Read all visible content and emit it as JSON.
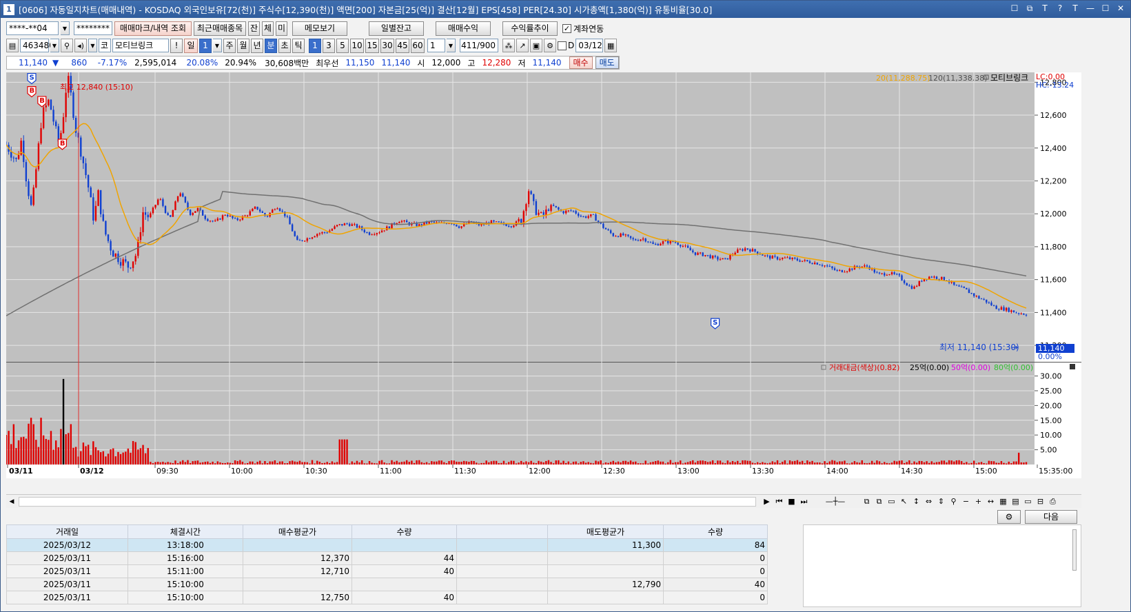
{
  "window": {
    "app_number": "1",
    "title": "[0606] 자동일지차트(매매내역) - KOSDAQ 외국인보유[72(천)] 주식수[12,390(천)] 액면[200] 자본금[25(억)] 결산[12월] EPS[458] PER[24.30] 시가총액[1,380(억)] 유통비율[30.0]",
    "buttons": [
      "☐",
      "⧉",
      "T",
      "?",
      "T",
      "—",
      "☐",
      "✕"
    ]
  },
  "toolbar1": {
    "account": "****-**04",
    "password": "********",
    "btn_trade_mark": "매매마크/내역 조회",
    "btn_recent": "최근매매종목",
    "btn_jan": "잔",
    "btn_che": "체",
    "btn_mi": "미",
    "btn_memo": "메모보기",
    "btn_daily": "일별잔고",
    "btn_profit": "매매수익",
    "btn_profit_rate": "수익률추이",
    "chk_account_link": "계좌연동"
  },
  "toolbar2": {
    "code": "463480",
    "market": "코",
    "stock_name": "모티브링크",
    "excl": "!",
    "period_day": "일",
    "period_day_n": "1",
    "periods": [
      "주",
      "월",
      "년",
      "분",
      "초",
      "틱"
    ],
    "minute_options": [
      "1",
      "3",
      "5",
      "10",
      "15",
      "30",
      "45",
      "60"
    ],
    "n_value": "1",
    "count": "411",
    "count_max": "/900",
    "d_label": "D",
    "date": "03/12"
  },
  "quote": {
    "price": "11,140",
    "arrow": "▼",
    "change": "860",
    "change_pct": "-7.17%",
    "volume": "2,595,014",
    "rate1": "20.08%",
    "rate2": "20.94%",
    "amount": "30,608백만",
    "best_label": "최우선",
    "best_ask": "11,150",
    "best_bid": "11,140",
    "open_label": "시",
    "open": "12,000",
    "high_label": "고",
    "high": "12,280",
    "low_label": "저",
    "low": "11,140",
    "btn_buy": "매수",
    "btn_sell": "매도"
  },
  "chart_data": {
    "type": "candlestick",
    "price_axis": {
      "ticks": [
        "12,800",
        "12,600",
        "12,400",
        "12,200",
        "12,000",
        "11,800",
        "11,600",
        "11,400",
        "11,200"
      ],
      "range": [
        11100,
        12860
      ]
    },
    "time_labels": [
      "03/11",
      "03/12",
      "09:30",
      "10:00",
      "10:30",
      "11:00",
      "11:30",
      "12:00",
      "12:30",
      "13:00",
      "13:30",
      "14:00",
      "14:30",
      "15:00",
      "15:35:00"
    ],
    "legend": {
      "ma20": "20(11,288.75)",
      "ma120": "120(11,338.38)",
      "stock": "모티브링크",
      "lc": "LC:0.00",
      "hc": "HC:-13.24"
    },
    "annotations": {
      "high": "최고 12,840 (15:10)",
      "low": "최저 11,140 (15:30)",
      "last_price": "11,140",
      "last_pct": "0.00%"
    },
    "ma20_color": "#f0a400",
    "ma120_color": "#707070",
    "up_color": "#e00000",
    "down_color": "#1040d0",
    "trade_marks": [
      {
        "type": "S",
        "t": 0.025,
        "price": 12820
      },
      {
        "type": "B",
        "t": 0.025,
        "price": 12740
      },
      {
        "type": "B",
        "t": 0.035,
        "price": 12680
      },
      {
        "type": "B",
        "t": 0.055,
        "price": 12420
      },
      {
        "type": "S",
        "t": 0.695,
        "price": 11330
      }
    ],
    "price_path": [
      [
        0.0,
        12420
      ],
      [
        0.01,
        12320
      ],
      [
        0.015,
        12450
      ],
      [
        0.02,
        12200
      ],
      [
        0.025,
        12020
      ],
      [
        0.03,
        12310
      ],
      [
        0.035,
        12600
      ],
      [
        0.042,
        12690
      ],
      [
        0.048,
        12520
      ],
      [
        0.052,
        12420
      ],
      [
        0.056,
        12600
      ],
      [
        0.06,
        12840
      ],
      [
        0.064,
        12700
      ],
      [
        0.068,
        12520
      ],
      [
        0.074,
        12360
      ],
      [
        0.08,
        12180
      ],
      [
        0.086,
        11960
      ],
      [
        0.09,
        12130
      ],
      [
        0.096,
        11900
      ],
      [
        0.104,
        11770
      ],
      [
        0.112,
        11720
      ],
      [
        0.12,
        11680
      ],
      [
        0.128,
        11760
      ],
      [
        0.134,
        12010
      ],
      [
        0.14,
        11980
      ],
      [
        0.15,
        12100
      ],
      [
        0.16,
        11960
      ],
      [
        0.17,
        12140
      ],
      [
        0.18,
        12000
      ],
      [
        0.188,
        12030
      ],
      [
        0.196,
        11970
      ],
      [
        0.205,
        11950
      ],
      [
        0.215,
        12000
      ],
      [
        0.225,
        11960
      ],
      [
        0.235,
        11990
      ],
      [
        0.245,
        12040
      ],
      [
        0.255,
        11980
      ],
      [
        0.265,
        12050
      ],
      [
        0.275,
        11980
      ],
      [
        0.285,
        11830
      ],
      [
        0.295,
        11850
      ],
      [
        0.305,
        11880
      ],
      [
        0.315,
        11890
      ],
      [
        0.325,
        11930
      ],
      [
        0.335,
        11940
      ],
      [
        0.345,
        11920
      ],
      [
        0.355,
        11880
      ],
      [
        0.365,
        11890
      ],
      [
        0.375,
        11920
      ],
      [
        0.385,
        11960
      ],
      [
        0.395,
        11940
      ],
      [
        0.405,
        11930
      ],
      [
        0.415,
        11950
      ],
      [
        0.425,
        11940
      ],
      [
        0.435,
        11950
      ],
      [
        0.445,
        11920
      ],
      [
        0.455,
        11950
      ],
      [
        0.465,
        11930
      ],
      [
        0.475,
        11950
      ],
      [
        0.485,
        11940
      ],
      [
        0.495,
        11930
      ],
      [
        0.505,
        11960
      ],
      [
        0.512,
        12150
      ],
      [
        0.518,
        12030
      ],
      [
        0.525,
        11980
      ],
      [
        0.535,
        12050
      ],
      [
        0.545,
        12010
      ],
      [
        0.555,
        12020
      ],
      [
        0.565,
        11980
      ],
      [
        0.575,
        11990
      ],
      [
        0.585,
        11920
      ],
      [
        0.595,
        11870
      ],
      [
        0.605,
        11870
      ],
      [
        0.615,
        11840
      ],
      [
        0.625,
        11850
      ],
      [
        0.635,
        11810
      ],
      [
        0.645,
        11830
      ],
      [
        0.655,
        11830
      ],
      [
        0.665,
        11800
      ],
      [
        0.675,
        11760
      ],
      [
        0.685,
        11750
      ],
      [
        0.695,
        11730
      ],
      [
        0.705,
        11720
      ],
      [
        0.715,
        11770
      ],
      [
        0.725,
        11790
      ],
      [
        0.735,
        11770
      ],
      [
        0.745,
        11740
      ],
      [
        0.755,
        11730
      ],
      [
        0.765,
        11730
      ],
      [
        0.775,
        11720
      ],
      [
        0.785,
        11710
      ],
      [
        0.795,
        11700
      ],
      [
        0.805,
        11680
      ],
      [
        0.815,
        11650
      ],
      [
        0.825,
        11660
      ],
      [
        0.835,
        11680
      ],
      [
        0.845,
        11680
      ],
      [
        0.855,
        11630
      ],
      [
        0.865,
        11640
      ],
      [
        0.875,
        11620
      ],
      [
        0.885,
        11560
      ],
      [
        0.89,
        11550
      ],
      [
        0.898,
        11600
      ],
      [
        0.906,
        11620
      ],
      [
        0.914,
        11610
      ],
      [
        0.922,
        11600
      ],
      [
        0.93,
        11560
      ],
      [
        0.94,
        11540
      ],
      [
        0.95,
        11500
      ],
      [
        0.96,
        11470
      ],
      [
        0.97,
        11430
      ],
      [
        0.98,
        11420
      ],
      [
        0.99,
        11400
      ],
      [
        1.0,
        11390
      ]
    ],
    "volume_panel": {
      "legend_label": "거래대금(색상)(0.82)",
      "legend_25": "25억(0.00)",
      "legend_50": "50억(0.00)",
      "legend_80": "80억(0.00)",
      "ticks": [
        "30.00",
        "25.00",
        "20.00",
        "15.00",
        "10.00",
        "5.00"
      ],
      "range": [
        0,
        32
      ]
    }
  },
  "grid": {
    "next_button": "다음",
    "headers": [
      "거래일",
      "체결시간",
      "매수평균가",
      "수량",
      "",
      "매도평균가",
      "수량"
    ],
    "rows": [
      {
        "date": "2025/03/12",
        "time": "13:18:00",
        "buy_avg": "",
        "buy_qty": "",
        "sell_avg": "11,300",
        "sell_qty": "84"
      },
      {
        "date": "2025/03/11",
        "time": "15:16:00",
        "buy_avg": "12,370",
        "buy_qty": "44",
        "sell_avg": "",
        "sell_qty": "0"
      },
      {
        "date": "2025/03/11",
        "time": "15:11:00",
        "buy_avg": "12,710",
        "buy_qty": "40",
        "sell_avg": "",
        "sell_qty": "0"
      },
      {
        "date": "2025/03/11",
        "time": "15:10:00",
        "buy_avg": "",
        "buy_qty": "",
        "sell_avg": "12,790",
        "sell_qty": "40"
      },
      {
        "date": "2025/03/11",
        "time": "15:10:00",
        "buy_avg": "12,750",
        "buy_qty": "40",
        "sell_avg": "",
        "sell_qty": "0"
      }
    ]
  }
}
